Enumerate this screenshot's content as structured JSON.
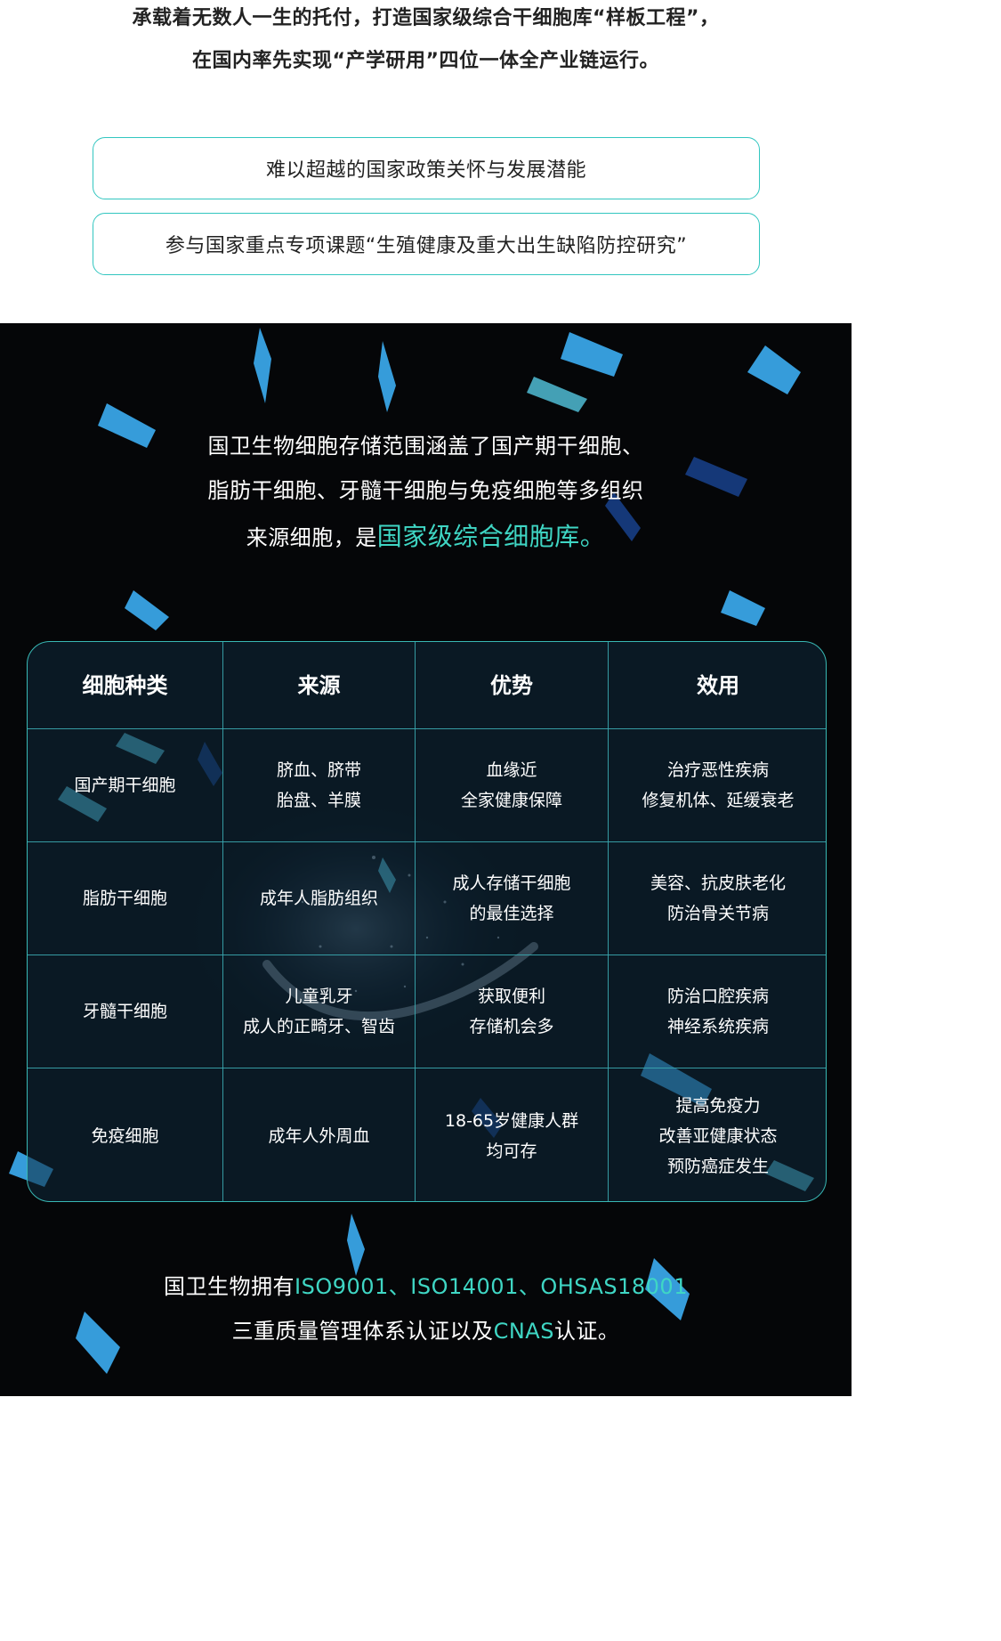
{
  "intro": {
    "line1": "承载着无数人一生的托付，打造国家级综合干细胞库“样板工程”，",
    "line2": "在国内率先实现“产学研用”四位一体全产业链运行。"
  },
  "highlights": [
    "难以超越的国家政策关怀与发展潜能",
    "参与国家重点专项课题“生殖健康及重大出生缺陷防控研究”"
  ],
  "description": {
    "line1": "国卫生物细胞存储范围涵盖了国产期干细胞、",
    "line2": "脂肪干细胞、牙髓干细胞与免疫细胞等多组织",
    "line3_prefix": "来源细胞，是",
    "line3_highlight": "国家级综合细胞库。"
  },
  "table": {
    "headers": [
      "细胞种类",
      "来源",
      "优势",
      "效用"
    ],
    "rows": [
      {
        "type": "国产期干细胞",
        "source": [
          "脐血、脐带",
          "胎盘、羊膜"
        ],
        "advantage": [
          "血缘近",
          "全家健康保障"
        ],
        "effect": [
          "治疗恶性疾病",
          "修复机体、延缓衰老"
        ]
      },
      {
        "type": "脂肪干细胞",
        "source": [
          "成年人脂肪组织"
        ],
        "advantage": [
          "成人存储干细胞",
          "的最佳选择"
        ],
        "effect": [
          "美容、抗皮肤老化",
          "防治骨关节病"
        ]
      },
      {
        "type": "牙髓干细胞",
        "source": [
          "儿童乳牙",
          "成人的正畸牙、智齿"
        ],
        "advantage": [
          "获取便利",
          "存储机会多"
        ],
        "effect": [
          "防治口腔疾病",
          "神经系统疾病"
        ]
      },
      {
        "type": "免疫细胞",
        "source": [
          "成年人外周血"
        ],
        "advantage": [
          "18-65岁健康人群",
          "均可存"
        ],
        "effect": [
          "提高免疫力",
          "改善亚健康状态",
          "预防癌症发生"
        ]
      }
    ]
  },
  "certification": {
    "line1_prefix": "国卫生物拥有",
    "line1_highlight": "ISO9001、ISO14001、OHSAS18001",
    "line2_prefix": "三重质量管理体系认证以及",
    "line2_highlight": "CNAS",
    "line2_suffix": "认证。"
  },
  "colors": {
    "accent": "#3fd6c4",
    "border": "#38b8b4",
    "dark_bg": "#050608"
  }
}
